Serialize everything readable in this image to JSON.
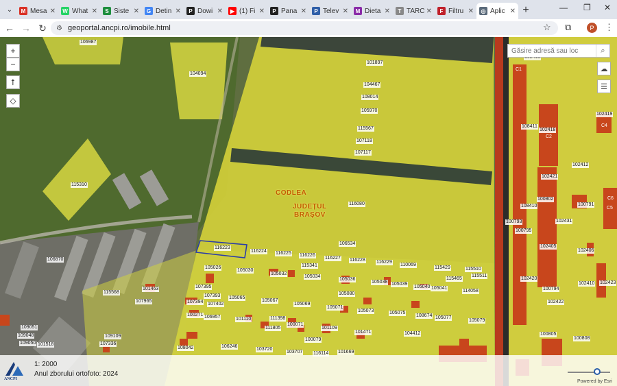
{
  "browser": {
    "tabs": [
      {
        "label": "Mesa",
        "icon": "gmail-icon",
        "color": "#d93025",
        "glyph": "M"
      },
      {
        "label": "What",
        "icon": "whatsapp-icon",
        "color": "#25d366",
        "glyph": "W"
      },
      {
        "label": "Siste",
        "icon": "drive-icon",
        "color": "#1e8e3e",
        "glyph": "S"
      },
      {
        "label": "Detin",
        "icon": "google-icon",
        "color": "#4285f4",
        "glyph": "G"
      },
      {
        "label": "Dowi",
        "icon": "p-icon",
        "color": "#222222",
        "glyph": "P"
      },
      {
        "label": "(1) Fi",
        "icon": "youtube-icon",
        "color": "#ff0000",
        "glyph": "▶"
      },
      {
        "label": "Pana",
        "icon": "p-icon",
        "color": "#222222",
        "glyph": "P"
      },
      {
        "label": "Telev",
        "icon": "p-blue-icon",
        "color": "#2f5fa8",
        "glyph": "P"
      },
      {
        "label": "Dieta",
        "icon": "ma-icon",
        "color": "#8a2ba8",
        "glyph": "M"
      },
      {
        "label": "TARC",
        "icon": "tarc-icon",
        "color": "#888888",
        "glyph": "T"
      },
      {
        "label": "Filtru",
        "icon": "filter-icon",
        "color": "#c0202a",
        "glyph": "F"
      },
      {
        "label": "Aplic",
        "icon": "globe-icon",
        "color": "#5a6a7a",
        "glyph": "◎",
        "active": true
      }
    ],
    "new_tab": "+",
    "url": "geoportal.ancpi.ro/imobile.html",
    "profile_initial": "P"
  },
  "map": {
    "search_placeholder": "Găsire adresă sau loc",
    "zoom_in": "+",
    "zoom_out": "−",
    "place_labels": {
      "town": "CODLEA",
      "county_line1": "JUDEȚUL",
      "county_line2": "BRAȘOV"
    },
    "parcels": [
      {
        "id": "106987"
      },
      {
        "id": "104094"
      },
      {
        "id": "101897"
      },
      {
        "id": "104467"
      },
      {
        "id": "108014"
      },
      {
        "id": "105970"
      },
      {
        "id": "115567"
      },
      {
        "id": "107118"
      },
      {
        "id": "107117"
      },
      {
        "id": "115310"
      },
      {
        "id": "116080"
      },
      {
        "id": "106534"
      },
      {
        "id": "116223"
      },
      {
        "id": "116224"
      },
      {
        "id": "116225"
      },
      {
        "id": "116226"
      },
      {
        "id": "116227"
      },
      {
        "id": "116228"
      },
      {
        "id": "116229"
      },
      {
        "id": "110069"
      },
      {
        "id": "115429"
      },
      {
        "id": "115510"
      },
      {
        "id": "115511"
      },
      {
        "id": "115341"
      },
      {
        "id": "105026"
      },
      {
        "id": "105030"
      },
      {
        "id": "105032"
      },
      {
        "id": "105034"
      },
      {
        "id": "105036"
      },
      {
        "id": "105038"
      },
      {
        "id": "105039"
      },
      {
        "id": "105040"
      },
      {
        "id": "105041"
      },
      {
        "id": "115465"
      },
      {
        "id": "114058"
      },
      {
        "id": "106870"
      },
      {
        "id": "107395"
      },
      {
        "id": "107393"
      },
      {
        "id": "107394"
      },
      {
        "id": "107402"
      },
      {
        "id": "105065"
      },
      {
        "id": "105067"
      },
      {
        "id": "105069"
      },
      {
        "id": "105071"
      },
      {
        "id": "105073"
      },
      {
        "id": "105075"
      },
      {
        "id": "105080"
      },
      {
        "id": "108674"
      },
      {
        "id": "105077"
      },
      {
        "id": "105079"
      },
      {
        "id": "115568"
      },
      {
        "id": "101463"
      },
      {
        "id": "107965"
      },
      {
        "id": "100271"
      },
      {
        "id": "106957"
      },
      {
        "id": "101110"
      },
      {
        "id": "111398"
      },
      {
        "id": "111805"
      },
      {
        "id": "100071"
      },
      {
        "id": "101109"
      },
      {
        "id": "101471"
      },
      {
        "id": "104412"
      },
      {
        "id": "109051"
      },
      {
        "id": "109048"
      },
      {
        "id": "109050"
      },
      {
        "id": "101518"
      },
      {
        "id": "109109"
      },
      {
        "id": "107336"
      },
      {
        "id": "108042"
      },
      {
        "id": "106246"
      },
      {
        "id": "103720"
      },
      {
        "id": "100079"
      },
      {
        "id": "103707"
      },
      {
        "id": "116114"
      },
      {
        "id": "101669"
      },
      {
        "id": "102415"
      },
      {
        "id": "108411"
      },
      {
        "id": "102418"
      },
      {
        "id": "102419"
      },
      {
        "id": "102412"
      },
      {
        "id": "102421"
      },
      {
        "id": "108410"
      },
      {
        "id": "100802"
      },
      {
        "id": "100791"
      },
      {
        "id": "100793"
      },
      {
        "id": "102431"
      },
      {
        "id": "100795"
      },
      {
        "id": "102405"
      },
      {
        "id": "102406"
      },
      {
        "id": "102420"
      },
      {
        "id": "102410"
      },
      {
        "id": "102423"
      },
      {
        "id": "100794"
      },
      {
        "id": "102422"
      },
      {
        "id": "100805"
      },
      {
        "id": "100808"
      }
    ],
    "building_codes": [
      "C1",
      "C2",
      "C4",
      "C6",
      "C5"
    ],
    "footer": {
      "scale": "1: 2000",
      "year": "Anul zborului ortofoto: 2024",
      "logo_text": "ANCPI",
      "powered": "Powered by Esri"
    }
  }
}
